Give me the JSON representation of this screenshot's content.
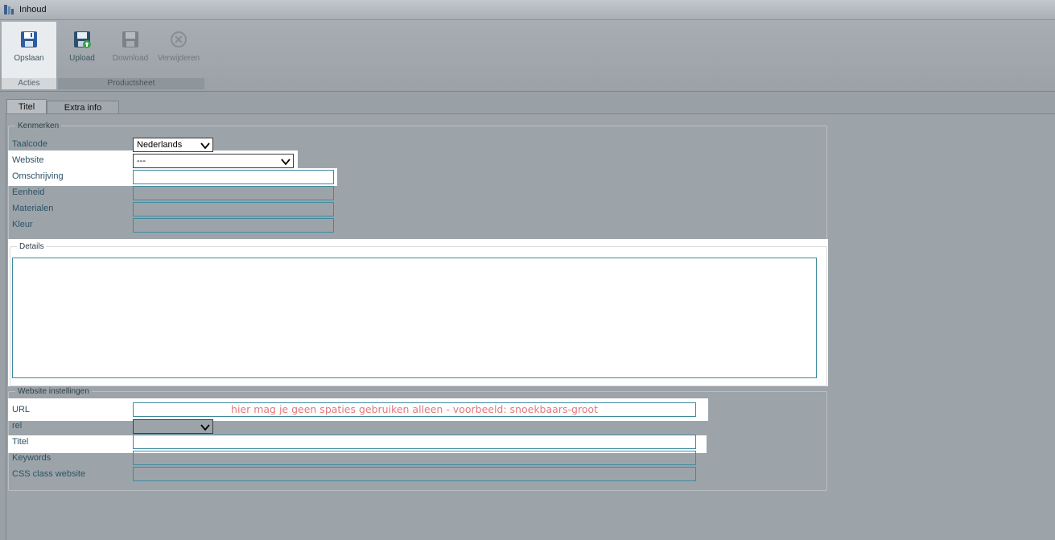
{
  "window": {
    "title": "Inhoud",
    "icon": "app-icon"
  },
  "ribbon": {
    "groups": [
      {
        "label": "Acties",
        "buttons": [
          {
            "label": "Opslaan",
            "icon": "save-icon",
            "enabled": true
          }
        ]
      },
      {
        "label": "Productsheet",
        "buttons": [
          {
            "label": "Upload",
            "icon": "upload-icon",
            "enabled": true
          },
          {
            "label": "Download",
            "icon": "download-icon",
            "enabled": false
          },
          {
            "label": "Verwijderen",
            "icon": "delete-icon",
            "enabled": false
          }
        ]
      }
    ]
  },
  "tabs": [
    {
      "label": "Titel",
      "active": true
    },
    {
      "label": "Extra info",
      "active": false
    }
  ],
  "kenmerken": {
    "legend": "Kenmerken",
    "taalcode": {
      "label": "Taalcode",
      "value": "Nederlands"
    },
    "website": {
      "label": "Website",
      "value": "---"
    },
    "omschrijving": {
      "label": "Omschrijving",
      "value": ""
    },
    "eenheid": {
      "label": "Eenheid",
      "value": ""
    },
    "materialen": {
      "label": "Materialen",
      "value": ""
    },
    "kleur": {
      "label": "Kleur",
      "value": ""
    }
  },
  "details": {
    "legend": "Details",
    "value": ""
  },
  "website_instellingen": {
    "legend": "Website instellingen",
    "url": {
      "label": "URL",
      "value": "",
      "hint": "hier mag je geen spaties gebruiken alleen - voorbeeld:  snoekbaars-groot"
    },
    "rel": {
      "label": "rel",
      "value": ""
    },
    "titel": {
      "label": "Titel",
      "value": ""
    },
    "keywords": {
      "label": "Keywords",
      "value": ""
    },
    "css_class": {
      "label": "CSS class website",
      "value": ""
    }
  },
  "colors": {
    "highlight": "#ffffff",
    "field_border": "#3f8aa0",
    "hint_text": "#e3787c",
    "background": "#9da4a9"
  }
}
